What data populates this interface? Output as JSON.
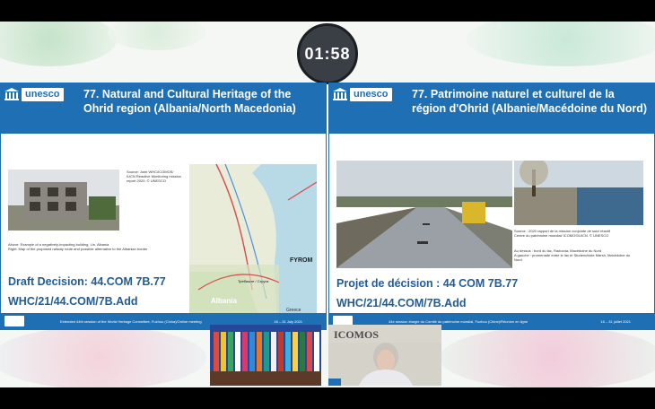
{
  "timer": {
    "value": "01:58"
  },
  "slides": {
    "left": {
      "logo_text": "unesco",
      "title": "77. Natural and Cultural Heritage of the Ohrid region (Albania/North Macedonia)",
      "source_caption": "Source: Joint WHC/ICOMOS/ IUCN Reactive Monitoring mission report 2020. © UNESCO",
      "photo_caption": "Above: Example of a negatively-impacting building, Lin, Albania\nRight: Map of the proposed railway route and possible alternative to the Albanian border",
      "map_label_country": "FYROM",
      "map_label_albania": "Albania",
      "map_label_greece": "Greece",
      "map_label_town": "Требиште / Струга",
      "decision_line1": "Draft Decision: 44.COM 7B.77",
      "decision_line2": "WHC/21/44.COM/7B.Add",
      "footer_text": "Extended 44th session of the World Heritage Committee, Fuzhou (China)/Online meeting",
      "footer_date": "16 – 31 July 2021"
    },
    "right": {
      "logo_text": "unesco",
      "title": "77. Patrimoine naturel et culturel de la région d'Ohrid (Albanie/Macédoine du Nord)",
      "source_caption": "Source : 2020 rapport de la mission conjointe de suivi réactif Centre du patrimoine mondial/ ICOMOS/UICN. © UNESCO",
      "photo_caption": "Au dessus : bord du lac, Radozda, Macédoine du Nord\nA gauche : promenade entre le lac et Studenchiste Marsh, Macédoine du Nord",
      "decision_line1": "Projet de décision : 44 COM 7B.77",
      "decision_line2": "WHC/21/44.COM/7B.Add",
      "footer_text": "44e session élargie du Comité du patrimoine mondial, Fuzhou (Chine)/Réunion en ligne",
      "footer_date": "16 – 31 juillet 2021"
    }
  },
  "speaker_thumb": {
    "org_label": "ICOMOS"
  },
  "colors": {
    "unesco_blue": "#1f6fb5",
    "decision_blue": "#1f5c99",
    "timer_bg": "#3a3f45"
  }
}
